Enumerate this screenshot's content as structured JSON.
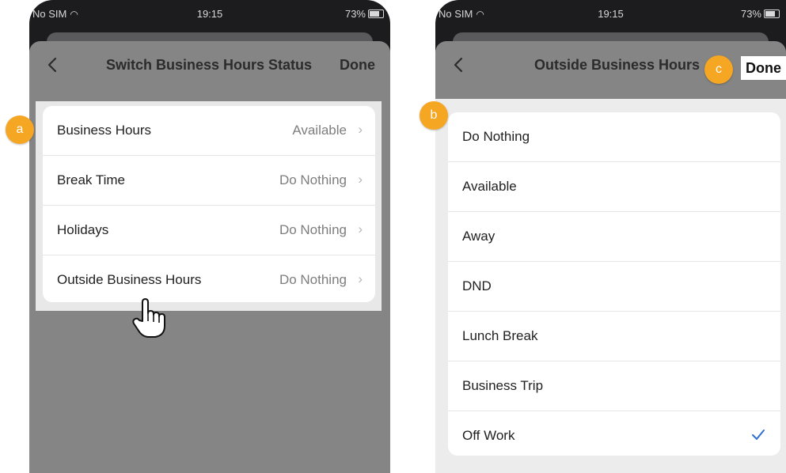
{
  "left_screen": {
    "status_bar": {
      "carrier": "No SIM",
      "time": "19:15",
      "battery": "73%"
    },
    "nav": {
      "title": "Switch Business Hours Status",
      "done_label": "Done",
      "back_icon": "chevron-left-icon"
    },
    "rows": [
      {
        "label": "Business Hours",
        "value": "Available"
      },
      {
        "label": "Break Time",
        "value": "Do Nothing"
      },
      {
        "label": "Holidays",
        "value": "Do Nothing"
      },
      {
        "label": "Outside Business Hours",
        "value": "Do Nothing"
      }
    ]
  },
  "right_screen": {
    "status_bar": {
      "carrier": "No SIM",
      "time": "19:15",
      "battery": "73%"
    },
    "nav": {
      "title": "Outside Business Hours",
      "done_label": "Done",
      "back_icon": "chevron-left-icon"
    },
    "options": [
      {
        "label": "Do Nothing"
      },
      {
        "label": "Available"
      },
      {
        "label": "Away"
      },
      {
        "label": "DND"
      },
      {
        "label": "Lunch Break"
      },
      {
        "label": "Business Trip"
      },
      {
        "label": "Off Work",
        "selected": true
      }
    ]
  },
  "annotations": {
    "a": "a",
    "b": "b",
    "c": "c"
  },
  "colors": {
    "badge": "#f5a623",
    "check": "#2f6fd1",
    "dim_overlay": "#858585"
  }
}
